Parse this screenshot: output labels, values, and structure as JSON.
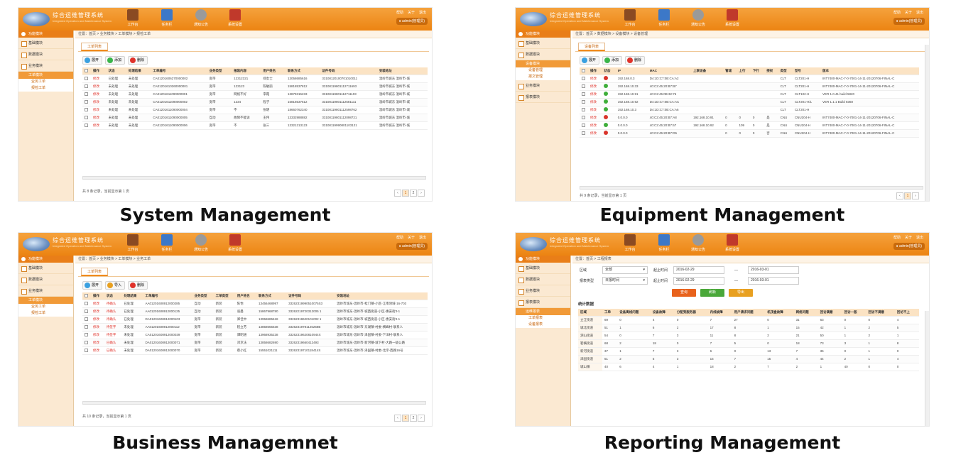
{
  "header": {
    "app_title": "综合运维管理系统",
    "app_subtitle": "Integrated Operation and Maintenance System",
    "nav": [
      {
        "label": "工作台",
        "icon": "book-icon",
        "color": "#8a4a22"
      },
      {
        "label": "任务栏",
        "icon": "pencil-note-icon",
        "color": "#3c78c8"
      },
      {
        "label": "通知公告",
        "icon": "satellite-dish-icon",
        "color": "#9a9a9a"
      },
      {
        "label": "系统设置",
        "icon": "tools-icon",
        "color": "#c0392b"
      }
    ],
    "top_links": [
      "帮助",
      "关于",
      "退出"
    ],
    "user": "admin(管理员)"
  },
  "panels": [
    {
      "caption": "System Management",
      "sidebar": {
        "head": "功能模块",
        "items": [
          "基础模块",
          "数据模块",
          "业务模块"
        ],
        "sub": "工单模块",
        "leaves": [
          "业务工单",
          "报检工单"
        ]
      },
      "breadcrumb": "位置：首页 > 业务模块 > 工单模块 > 报检工单",
      "tab": "工单列表",
      "tools": [
        {
          "label": "展开",
          "color": "#3aa0e0"
        },
        {
          "label": "添加",
          "color": "#39b54a"
        },
        {
          "label": "删除",
          "color": "#e0322a"
        }
      ],
      "columns": [
        "",
        "操作",
        "状态",
        "处理结果",
        "工单编号",
        "业务类型",
        "报装内容",
        "用户姓名",
        "联系方式",
        "证件号码",
        "安装地址"
      ],
      "rows": [
        [
          "修改",
          "已处理",
          "未处理",
          "CA01201606270000002",
          "宽带",
          "12312321",
          "郑女士",
          "13058685616",
          "33108120100701010011",
          "温岭市城东 温岭市-城"
        ],
        [
          "修改",
          "未处理",
          "未处理",
          "CA01201610260000001",
          "宽带",
          "123123",
          "陈敏丽",
          "15818537812",
          "33108119801112711693",
          "温岭市城东 温岭市-城"
        ],
        [
          "修改",
          "未处理",
          "未处理",
          "CA01201611090000001",
          "宽带",
          "网络不好",
          "李霞",
          "13879315233",
          "33108119801112711103",
          "温岭市城东 温岭市-城"
        ],
        [
          "修改",
          "未处理",
          "未处理",
          "CA01201611090000002",
          "宽带",
          "1234",
          "程子",
          "15818537612",
          "33108119801112581111",
          "温岭市城东 温岭市-城"
        ],
        [
          "修改",
          "未处理",
          "未处理",
          "CA01201611090000004",
          "宽带",
          "不",
          "张明",
          "18660762340",
          "33108119801112598762",
          "温岭市城东 温岭市-城"
        ],
        [
          "修改",
          "未处理",
          "未处理",
          "CA01201611090000005",
          "互动",
          "故障不能详",
          "王伟",
          "13332988882",
          "33108119801112098721",
          "温岭市城东 温岭市-城"
        ],
        [
          "修改",
          "未处理",
          "未处理",
          "CA01201611090000006",
          "宽带",
          "不",
          "张三",
          "13321213123",
          "33108119990801103121",
          "温岭市城东 温岭市-城"
        ]
      ],
      "footer": "共 8 条记录，当前显示第 1 页",
      "pages": [
        "‹",
        "1",
        "2",
        "›"
      ]
    },
    {
      "caption": "Equipment Management",
      "sidebar": {
        "head": "功能模块",
        "items": [
          "基础模块",
          "数据模块"
        ],
        "sub": "设备模块",
        "leaves": [
          "设备管理",
          "报文管理"
        ],
        "items2": [
          "业务模块",
          "报表模块"
        ]
      },
      "breadcrumb": "位置：首页 > 数据模块 > 设备模块 > 设备管理",
      "tab": "设备列表",
      "tools": [
        {
          "label": "展开",
          "color": "#3aa0e0"
        },
        {
          "label": "添加",
          "color": "#39b54a"
        },
        {
          "label": "删除",
          "color": "#e0322a"
        }
      ],
      "columns": [
        "",
        "操作",
        "状态",
        "IP",
        "MAC",
        "上联设备",
        "管城",
        "上行",
        "下行",
        "授权",
        "类型",
        "型号",
        "版本"
      ],
      "rows": [
        [
          "修改",
          "red",
          "192.168.0.3",
          "D4:1D:C7:0B:CA:A2",
          "",
          "",
          "",
          "",
          "",
          "CLT",
          "CLT201-H",
          "INT7400-MAC-7-0-7001-14-11-20120706-FINAL-C"
        ],
        [
          "修改",
          "green",
          "192.168.10.33",
          "40:C2:45:20:B7:B7",
          "",
          "",
          "",
          "",
          "",
          "CLT",
          "CLT201-H",
          "INT7400-MAC-7-0-7001-14-11-20120706-FINAL-C"
        ],
        [
          "修改",
          "green",
          "192.168.10.91",
          "40:C2:45:0B:32:76",
          "",
          "",
          "",
          "",
          "",
          "CLT",
          "CLT102-H",
          "VER 1.0.41 build 5820"
        ],
        [
          "修改",
          "green",
          "192.168.10.92",
          "D4:1D:C7:0B:CA:AC",
          "",
          "",
          "",
          "",
          "",
          "CLT",
          "CLT201-H/L",
          "VER 1.1.1 Build 8360"
        ],
        [
          "修改",
          "green",
          "192.168.10.3",
          "D4:1D:C7:0B:CA:A6",
          "",
          "",
          "",
          "",
          "",
          "CLT",
          "CLT201-H",
          ""
        ],
        [
          "修改",
          "red",
          "0.0.0.0",
          "40:C2:45:20:B7:A8",
          "192.168.10.91",
          "0",
          "0",
          "0",
          "是",
          "CNU",
          "CNU204-H",
          "INT7400-MAC-7-0-7001-14-11-20120706-FINAL-C"
        ],
        [
          "修改",
          "green",
          "0.0.0.0",
          "40:C2:45:20:B7:67",
          "192.168.10.92",
          "0",
          "109",
          "0",
          "是",
          "CNU",
          "CNU204-H",
          "INT7400-MAC-7-0-7001-14-11-20120706-FINAL-C"
        ],
        [
          "修改",
          "red",
          "0.0.0.0",
          "40:C2:45:20:B7:D5",
          "",
          "0",
          "0",
          "0",
          "否",
          "CNU",
          "CNU204-H",
          "INT7400-MAC-7-0-7001-14-11-20120706-FINAL-C"
        ]
      ],
      "footer": "共 9 条记录，当前显示第 1 页",
      "pages": [
        "‹",
        "1",
        "›"
      ]
    },
    {
      "caption": "Business Managemnet",
      "sidebar": {
        "head": "功能模块",
        "items": [
          "基础模块",
          "数据模块",
          "业务模块"
        ],
        "sub": "工单模块",
        "leaves": [
          "业务工单",
          "报检工单"
        ]
      },
      "breadcrumb": "位置：首页 > 业务模块 > 工单模块 > 业务工单",
      "tab": "工单列表",
      "tools": [
        {
          "label": "展开",
          "color": "#3aa0e0"
        },
        {
          "label": "导入",
          "color": "#e8a020"
        },
        {
          "label": "删除",
          "color": "#e0322a"
        }
      ],
      "columns": [
        "",
        "操作",
        "状态",
        "处理结果",
        "工单编号",
        "业务类型",
        "工单类型",
        "用户姓名",
        "联系方式",
        "证件号码",
        "安装地址"
      ],
      "rows": [
        [
          "修改",
          "待确认",
          "已处理",
          "AA01201608912000285",
          "互动",
          "新装",
          "陈怡",
          "13456468997",
          "33262319990510075S3",
          "温岭市城东-温岭市-松门镇-小区-江南领域-16-703"
        ],
        [
          "修改",
          "待确认",
          "已处理",
          "AA01201608912000125",
          "互动",
          "新装",
          "张曼",
          "15867968780",
          "33262219720312005 1",
          "温岭市城东-温岭市-城西街道-小区-惠安街3-1"
        ],
        [
          "修改",
          "待确认",
          "已处理",
          "DA01201608912000103",
          "宽带",
          "新装",
          "郑佳中",
          "13958685618",
          "33262319620101002 1",
          "温岭市城东-温岭市-城西街道-小区-惠安街3-1"
        ],
        [
          "修改",
          "待签字",
          "未处理",
          "AA01201608912000112",
          "宽带",
          "新装",
          "程立芳",
          "13858655638",
          "33262319781125258B",
          "温岭市城东-温岭市-东湖镇-村委-横峰村-联系人"
        ],
        [
          "修改",
          "待签字",
          "未处理",
          "CA01201608912000039",
          "宽带",
          "新装",
          "谭明涵",
          "13968935238",
          "33262319620810944X",
          "温岭市城东-温岭市-泽国镇-村委-下洋村-联系人"
        ],
        [
          "修改",
          "已确认",
          "未处理",
          "DA01201608912000071",
          "宽带",
          "新装",
          "邓京法",
          "13858682690",
          "33262319660412493",
          "温岭市城东-温岭市-新河镇-城下村-大路一级公路"
        ],
        [
          "修改",
          "已确认",
          "未处理",
          "DA01201608912000070",
          "宽带",
          "新装",
          "蔡小红",
          "15551021111",
          "33262319710118414S",
          "温岭市城东-温岭市-泽国镇-村委-北岸-西路16号"
        ]
      ],
      "footer": "共 10 条记录，当前显示第 1 页",
      "pages": [
        "‹",
        "1",
        "2",
        "›"
      ]
    },
    {
      "caption": "Reporting Management",
      "sidebar": {
        "head": "功能模块",
        "items": [
          "基础模块",
          "数据模块",
          "业务模块",
          "报表模块"
        ],
        "sub": "运维报表",
        "leaves": [
          "工单报表",
          "设备报表"
        ]
      },
      "breadcrumb": "位置：首页 > 工程报表",
      "filters": {
        "area_label": "区域",
        "area_value": "全部",
        "start_label": "起止时间",
        "start_from": "2016-02-29",
        "start_to": "2016-03-01",
        "type_label": "报表类型",
        "type_value": "日报时间",
        "end_label": "起止时间",
        "end_from": "2016-02-29",
        "end_to": "2016-03-01",
        "sep": "—"
      },
      "actions": [
        {
          "label": "查询",
          "color": "#e8621c"
        },
        {
          "label": "刷新",
          "color": "#4aa83a"
        },
        {
          "label": "导出",
          "color": "#e8a020"
        }
      ],
      "section": "统计数据",
      "columns": [
        "区域",
        "工单",
        "设备离线问题",
        "设备故障",
        "分配到服务器",
        "内线故障",
        "用户请求问题",
        "机顶盒故障",
        "网络问题",
        "回访满意",
        "回访一般",
        "回访不满意",
        "回访不上"
      ],
      "rows": [
        [
          "立江街道",
          "69",
          "0",
          "4",
          "0",
          "7",
          "27",
          "0",
          "31",
          "63",
          "0",
          "0",
          "4"
        ],
        [
          "城北街道",
          "51",
          "1",
          "6",
          "2",
          "17",
          "8",
          "1",
          "15",
          "42",
          "1",
          "2",
          "5"
        ],
        [
          "泗山街道",
          "54",
          "0",
          "7",
          "3",
          "11",
          "8",
          "2",
          "21",
          "50",
          "1",
          "2",
          "1"
        ],
        [
          "箬横街道",
          "68",
          "2",
          "18",
          "0",
          "7",
          "5",
          "0",
          "18",
          "73",
          "3",
          "1",
          "8"
        ],
        [
          "新河街道",
          "37",
          "1",
          "7",
          "3",
          "6",
          "0",
          "13",
          "7",
          "36",
          "0",
          "1",
          "0"
        ],
        [
          "泽国街道",
          "51",
          "2",
          "5",
          "3",
          "15",
          "7",
          "15",
          "4",
          "44",
          "2",
          "1",
          "4"
        ],
        [
          "城山镇",
          "40",
          "6",
          "4",
          "1",
          "18",
          "2",
          "7",
          "2",
          "1",
          "40",
          "0",
          "0"
        ]
      ]
    }
  ]
}
